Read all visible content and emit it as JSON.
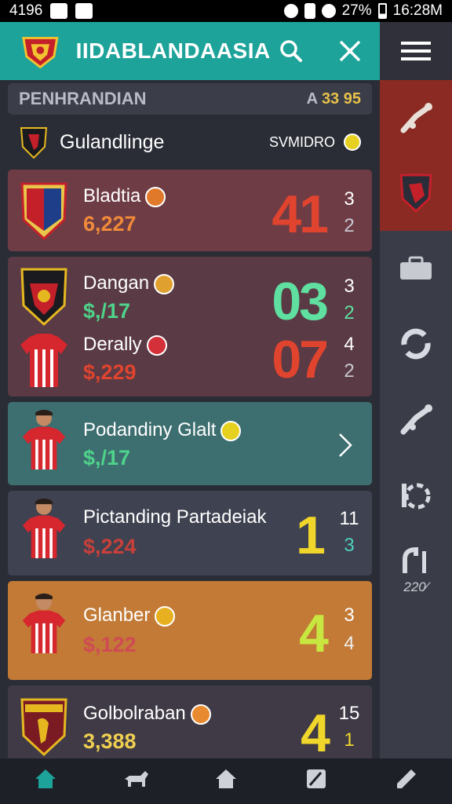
{
  "status": {
    "left": "4196",
    "right": "27%",
    "time": "16:28M"
  },
  "app": {
    "title": "IIDABLANDAASIA",
    "search_icon": "search-icon",
    "close_icon": "close-icon",
    "menu_icon": "menu-icon"
  },
  "section": {
    "label": "PENHRANDIAN",
    "value_prefix": "A",
    "value": "33 95"
  },
  "league": {
    "name": "Gulandlinge",
    "code": "SVMIDRO"
  },
  "cards": [
    {
      "bg": "#6e3c45",
      "rows": [
        {
          "name": "Bladtia",
          "price": "6,227",
          "price_color": "#f08a3a",
          "score": "41",
          "score_color": "#e0442e",
          "s1": "3",
          "s2": "2",
          "s2_color": "#c8cad2"
        }
      ]
    },
    {
      "bg": "#5a3a44",
      "rows": [
        {
          "name": "Dangan",
          "price": "$,/17",
          "price_color": "#4fd28a",
          "score": "03",
          "score_color": "#5fe0a0",
          "s1": "3",
          "s2": "2",
          "s2_color": "#5fe0a0"
        },
        {
          "name": "Derally",
          "price": "$,229",
          "price_color": "#e0442e",
          "score": "07",
          "score_color": "#e0442e",
          "s1": "4",
          "s2": "2",
          "s2_color": "#c8cad2"
        }
      ]
    },
    {
      "bg": "#3d6e70",
      "rows": [
        {
          "name": "Podandiny Glalt",
          "price": "$,/17",
          "price_color": "#4fd28a"
        }
      ]
    },
    {
      "bg": "#3f4250",
      "rows": [
        {
          "name": "Pictanding Partadeiak",
          "price": "$,224",
          "price_color": "#c8403a",
          "score": "1",
          "score_color": "#f0d62a",
          "s1": "11",
          "s2": "3",
          "s2_color": "#4fd2c0"
        }
      ]
    },
    {
      "bg": "#c27a36",
      "rows": [
        {
          "name": "Glanber",
          "price": "$,122",
          "price_color": "#d04a55",
          "score": "4",
          "score_color": "#c8e640",
          "s1": "3",
          "s2": "4",
          "s2_color": "#eee"
        }
      ]
    },
    {
      "bg": "#3f3a46",
      "rows": [
        {
          "name": "Golbolraban",
          "price": "3,388",
          "price_color": "#f0d050",
          "score": "4",
          "score_color": "#f0d62a",
          "s1": "15",
          "s2": "1",
          "s2_color": "#f0d62a"
        }
      ]
    }
  ],
  "rail": {
    "label": "220⁄"
  },
  "colors": {
    "teal": "#1da39a",
    "rail_active": "#8b2a22"
  }
}
